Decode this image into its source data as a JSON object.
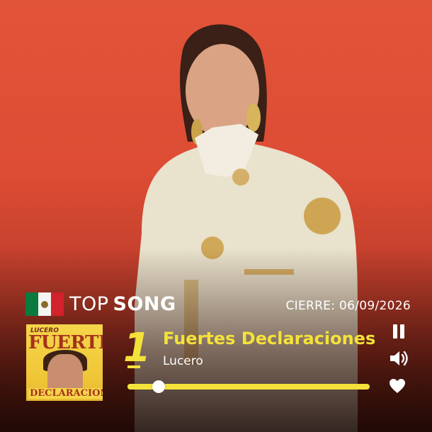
{
  "header": {
    "country_flag_icon": "mexico-flag-icon",
    "label_regular": "TOP",
    "label_bold": "SONG",
    "closing_text": "CIERRE: 06/09/2026"
  },
  "album_cover": {
    "top_text": "LUCERO",
    "main_text": "FUERTES",
    "bottom_text": "DECLARACIONES"
  },
  "track": {
    "rank": "1",
    "title": "Fuertes Declaraciones",
    "artist": "Lucero"
  },
  "player": {
    "progress_fraction": 0.13,
    "pause_icon": "pause-icon",
    "volume_icon": "volume-icon",
    "heart_icon": "heart-icon"
  },
  "colors": {
    "accent_yellow": "#f4e23a",
    "background_red": "#dd4c34"
  }
}
